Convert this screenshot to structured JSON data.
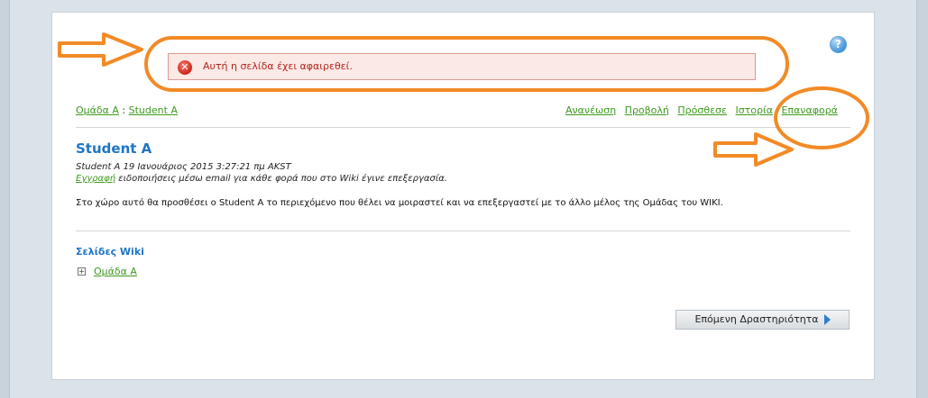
{
  "alert": {
    "message": "Αυτή η σελίδα έχει αφαιρεθεί."
  },
  "help": {
    "glyph": "?"
  },
  "breadcrumb": {
    "group": "Ομάδα Α",
    "separator": ":",
    "page": "Student A"
  },
  "actions": [
    "Ανανέωση",
    "Προβολή",
    "Πρόσθεσε",
    "Ιστορία",
    "Επαναφορά"
  ],
  "page": {
    "title": "Student A",
    "meta_line": "Student A 19 Ιανουάριος 2015 3:27:21 πμ AKST",
    "subscribe_link": "Εγγραφή",
    "subscribe_text": " ειδοποιήσεις μέσω email για κάθε φορά που στο Wiki έγινε επεξεργασία.",
    "body": "Στο χώρο αυτό θα προσθέσει ο Student A το περιεχόμενο που θέλει να μοιραστεί και να επεξεργαστεί με το άλλο μέλος της Ομάδας του WIKI."
  },
  "wiki_pages": {
    "heading": "Σελίδες Wiki",
    "items": [
      "Ομάδα Α"
    ]
  },
  "next_button": {
    "label": "Επόμενη Δραστηριότητα"
  },
  "colors": {
    "accent": "#1e75c5",
    "link": "#3d9a1e",
    "annotation": "#f28a26",
    "error": "#b0271c"
  }
}
